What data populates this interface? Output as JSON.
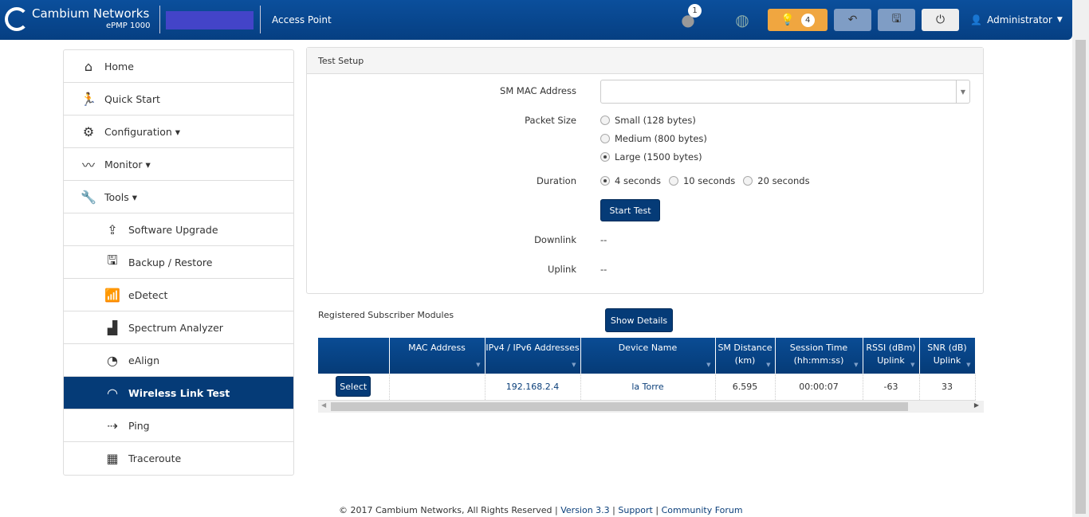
{
  "header": {
    "brand": "Cambium Networks",
    "model": "ePMP 1000",
    "mode": "Access Point",
    "users_badge": "1",
    "alerts_badge": "4",
    "user": "Administrator"
  },
  "sidebar": {
    "items": [
      {
        "label": "Home",
        "icon": "⌂",
        "name": "home"
      },
      {
        "label": "Quick Start",
        "icon": "🏃",
        "name": "quick-start"
      },
      {
        "label": "Configuration ▾",
        "icon": "⚙",
        "name": "configuration"
      },
      {
        "label": "Monitor ▾",
        "icon": "〰",
        "name": "monitor"
      },
      {
        "label": "Tools ▾",
        "icon": "🔧",
        "name": "tools"
      }
    ],
    "subitems": [
      {
        "label": "Software Upgrade",
        "icon": "⇪",
        "name": "software-upgrade"
      },
      {
        "label": "Backup / Restore",
        "icon": "🖫",
        "name": "backup-restore"
      },
      {
        "label": "eDetect",
        "icon": "📶",
        "name": "edetect"
      },
      {
        "label": "Spectrum Analyzer",
        "icon": "▟",
        "name": "spectrum-analyzer"
      },
      {
        "label": "eAlign",
        "icon": "◔",
        "name": "ealign"
      },
      {
        "label": "Wireless Link Test",
        "icon": "◠",
        "name": "wireless-link-test",
        "active": true
      },
      {
        "label": "Ping",
        "icon": "⇢",
        "name": "ping"
      },
      {
        "label": "Traceroute",
        "icon": "▦",
        "name": "traceroute"
      }
    ]
  },
  "test_setup": {
    "title": "Test Setup",
    "sm_mac_label": "SM MAC Address",
    "sm_mac_value": "",
    "packet_size_label": "Packet Size",
    "packet_sizes": [
      "Small (128 bytes)",
      "Medium (800 bytes)",
      "Large (1500 bytes)"
    ],
    "packet_size_selected": 2,
    "duration_label": "Duration",
    "durations": [
      "4 seconds",
      "10 seconds",
      "20 seconds"
    ],
    "duration_selected": 0,
    "start_button": "Start Test",
    "downlink_label": "Downlink",
    "downlink_value": "--",
    "uplink_label": "Uplink",
    "uplink_value": "--"
  },
  "registered": {
    "title": "Registered Subscriber Modules",
    "show_details": "Show Details",
    "columns": [
      "",
      "MAC Address",
      "IPv4 / IPv6 Addresses",
      "Device Name",
      "SM Distance (km)",
      "Session Time (hh:mm:ss)",
      "RSSI (dBm) Uplink",
      "SNR (dB) Uplink"
    ],
    "rows": [
      {
        "select": "Select",
        "mac": "",
        "ip": "192.168.2.4",
        "name": "la Torre",
        "distance": "6.595",
        "session": "00:00:07",
        "rssi": "-63",
        "snr": "33"
      }
    ]
  },
  "footer": {
    "copyright": "© 2017 Cambium Networks, All Rights Reserved",
    "version": "Version 3.3",
    "support": "Support",
    "forum": "Community Forum"
  }
}
